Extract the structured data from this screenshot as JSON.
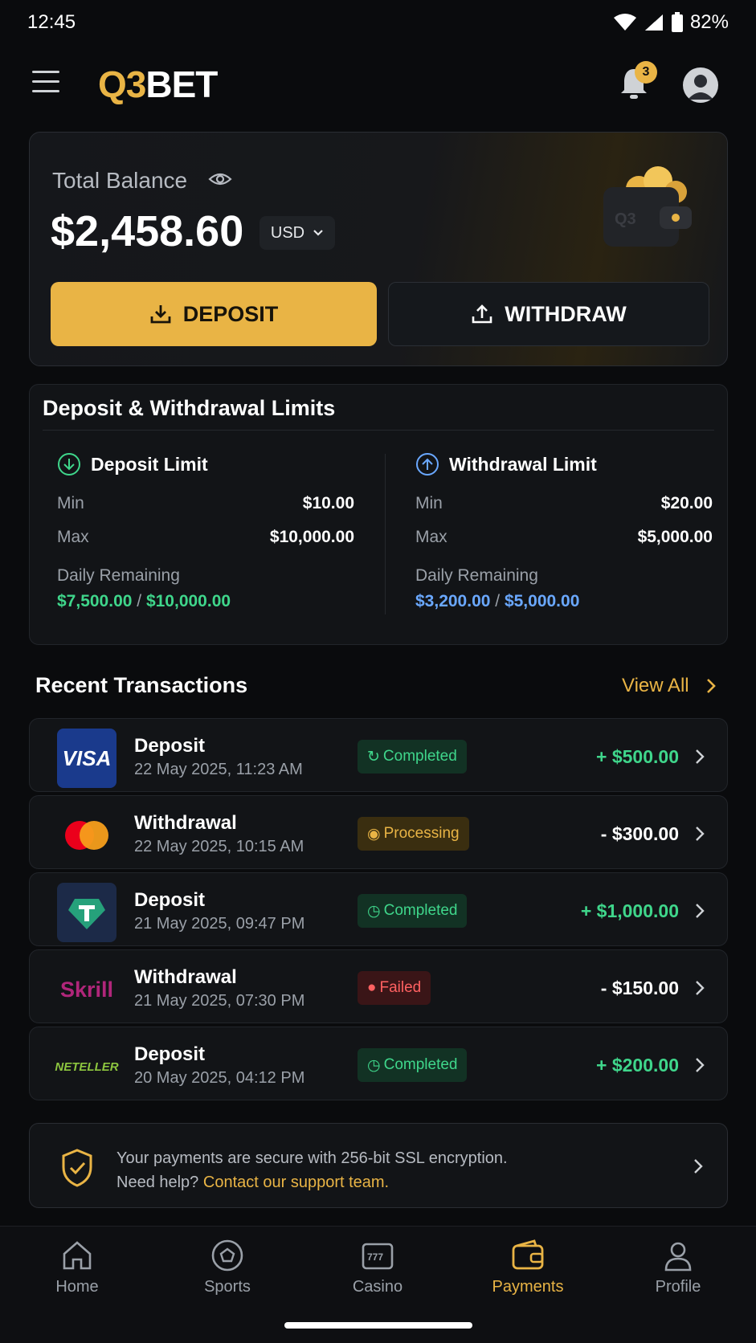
{
  "status_bar": {
    "time": "12:45",
    "battery": "82%"
  },
  "header": {
    "logo_q3": "Q3",
    "logo_bet": "BET",
    "notification_count": "3"
  },
  "balance": {
    "label": "Total Balance",
    "amount": "$2,458.60",
    "currency": "USD",
    "deposit_label": "DEPOSIT",
    "withdraw_label": "WITHDRAW"
  },
  "limits": {
    "title": "Deposit & Withdrawal Limits",
    "deposit": {
      "title": "Deposit Limit",
      "min_label": "Min",
      "min": "$10.00",
      "max_label": "Max",
      "max": "$10,000.00",
      "daily_label": "Daily Remaining",
      "remaining": "$7,500.00",
      "total": "$10,000.00"
    },
    "withdrawal": {
      "title": "Withdrawal Limit",
      "min_label": "Min",
      "min": "$20.00",
      "max_label": "Max",
      "max": "$5,000.00",
      "daily_label": "Daily Remaining",
      "remaining": "$3,200.00",
      "total": "$5,000.00"
    }
  },
  "recent": {
    "title": "Recent Transactions",
    "view_all": "View All",
    "transactions": [
      {
        "method": "VISA",
        "type": "Deposit",
        "date": "22 May 2025, 11:23 AM",
        "status": "Completed",
        "amount": "+ $500.00"
      },
      {
        "method": "Mastercard",
        "type": "Withdrawal",
        "date": "22 May 2025, 10:15 AM",
        "status": "Processing",
        "amount": "- $300.00"
      },
      {
        "method": "Tether",
        "type": "Deposit",
        "date": "21 May 2025, 09:47 PM",
        "status": "Completed",
        "amount": "+ $1,000.00"
      },
      {
        "method": "Skrill",
        "type": "Withdrawal",
        "date": "21 May 2025, 07:30 PM",
        "status": "Failed",
        "amount": "- $150.00"
      },
      {
        "method": "NETELLER",
        "type": "Deposit",
        "date": "20 May 2025, 04:12 PM",
        "status": "Completed",
        "amount": "+ $200.00"
      }
    ]
  },
  "secure": {
    "line1": "Your payments are secure with 256-bit SSL encryption.",
    "line2_prefix": "Need help?",
    "line2_link": "Contact our support team."
  },
  "nav": {
    "items": [
      {
        "label": "Home",
        "icon": "home-icon"
      },
      {
        "label": "Sports",
        "icon": "ball-icon"
      },
      {
        "label": "Casino",
        "icon": "slot-icon"
      },
      {
        "label": "Payments",
        "icon": "wallet-icon"
      },
      {
        "label": "Profile",
        "icon": "person-icon"
      }
    ],
    "active": "Payments"
  },
  "colors": {
    "accent": "#e9b445",
    "success": "#3fd68b",
    "info": "#6aa8ff",
    "danger": "#ff6161"
  }
}
